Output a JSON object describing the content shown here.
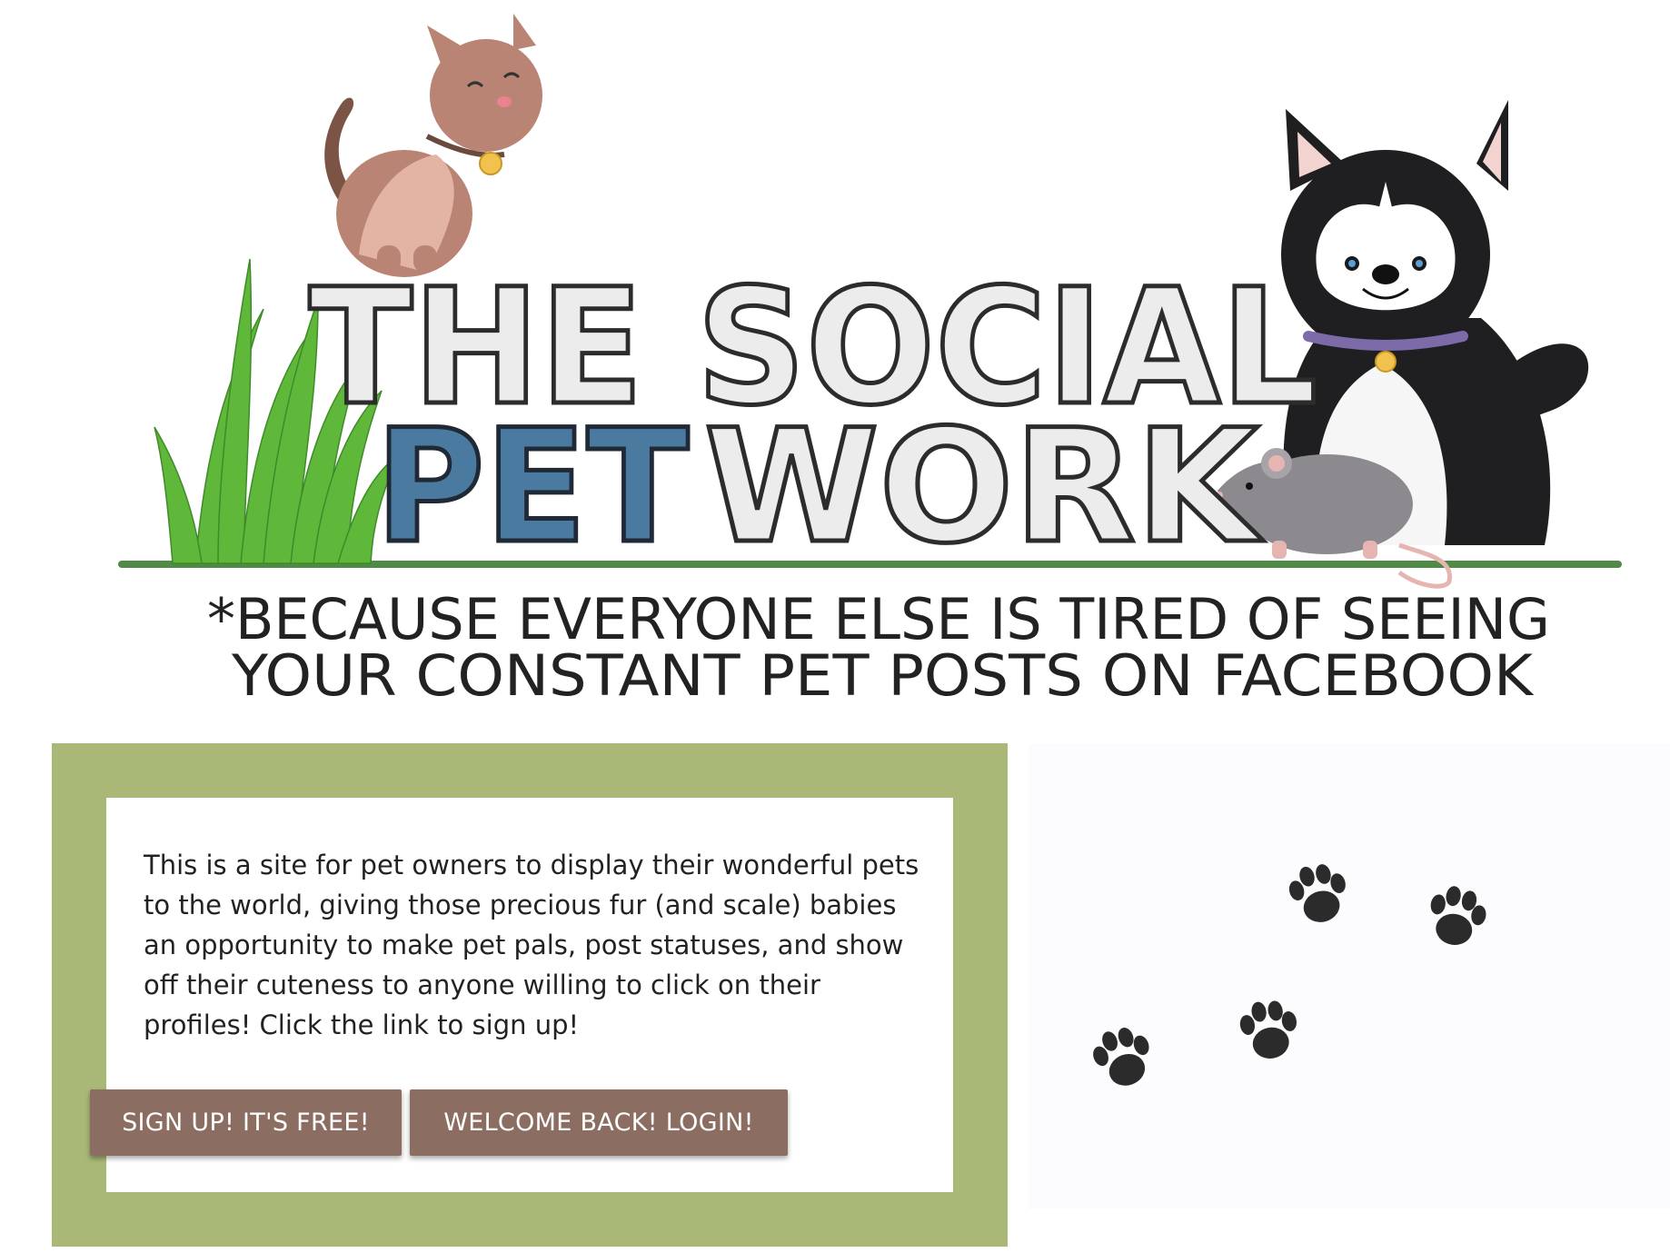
{
  "banner": {
    "title_line1": "THE SOCIAL",
    "title_line2_accent": "PET",
    "title_line2_rest": "WORK",
    "tagline_line1": "*BECAUSE EVERYONE ELSE IS TIRED OF SEEING",
    "tagline_line2": "YOUR CONSTANT PET POSTS ON FACEBOOK"
  },
  "info": {
    "description": "This is a site for pet owners to display their wonderful pets to the world, giving those precious fur (and scale) babies an opportunity to make pet pals, post statuses, and show off their cuteness to anyone willing to click on their profiles! Click the link to sign up!",
    "signup_label": "SIGN UP! IT'S FREE!",
    "login_label": "WELCOME BACK! LOGIN!"
  },
  "colors": {
    "panel_green": "#aab877",
    "button_brown": "#8c6d62",
    "title_blue": "#4a7aa0",
    "grass_line": "#4f8a47"
  }
}
